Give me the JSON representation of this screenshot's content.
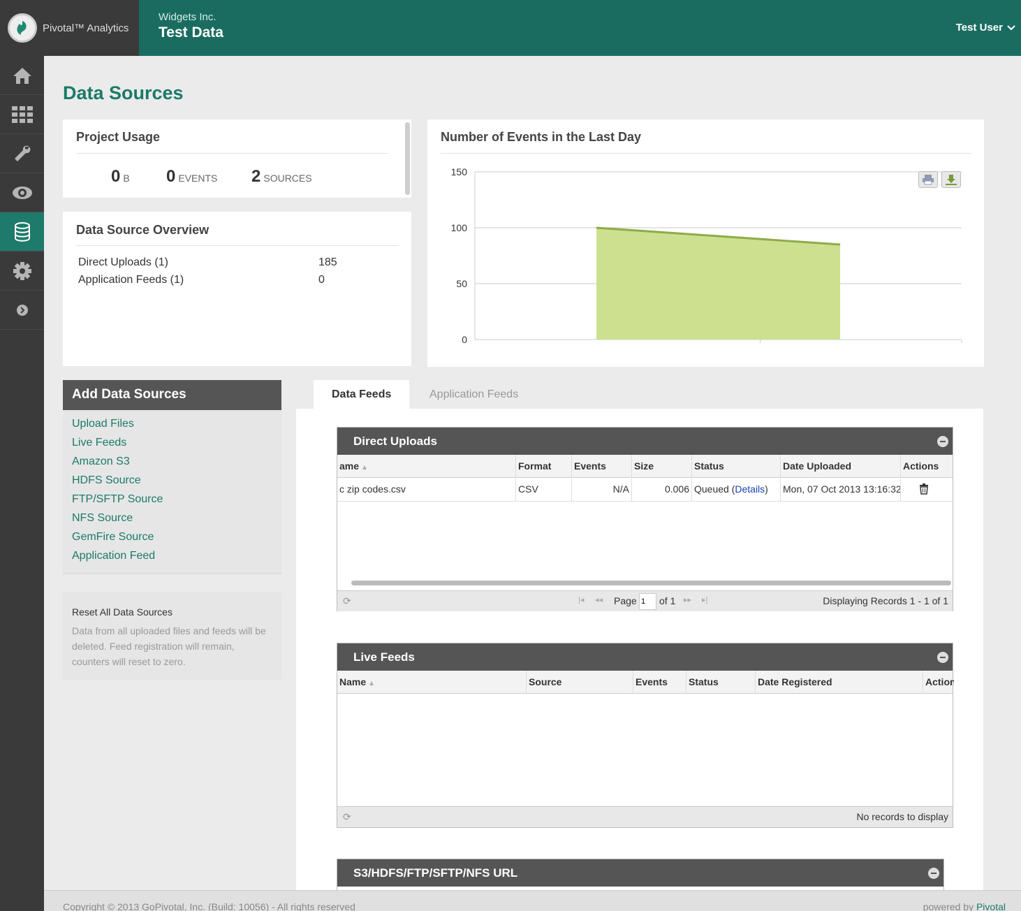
{
  "app": {
    "name": "Pivotal™ Analytics",
    "org": "Widgets Inc.",
    "project": "Test Data",
    "user": "Test User"
  },
  "sidebar": {
    "items": [
      {
        "icon": "home-icon"
      },
      {
        "icon": "grid-icon"
      },
      {
        "icon": "wrench-icon"
      },
      {
        "icon": "eye-icon"
      },
      {
        "icon": "database-icon",
        "active": true
      },
      {
        "icon": "gear-icon"
      },
      {
        "icon": "expand-arrow-icon"
      }
    ]
  },
  "page": {
    "title": "Data Sources"
  },
  "usage": {
    "title": "Project Usage",
    "bytes": {
      "value": "0",
      "unit": "B"
    },
    "events": {
      "value": "0",
      "unit": "EVENTS"
    },
    "sources": {
      "value": "2",
      "unit": "SOURCES"
    }
  },
  "overview": {
    "title": "Data Source Overview",
    "rows": [
      {
        "label": "Direct Uploads (1)",
        "value": "185"
      },
      {
        "label": "Application Feeds (1)",
        "value": "0"
      }
    ]
  },
  "chart_data": {
    "type": "area",
    "title": "Number of Events in the Last Day",
    "x": [
      0,
      1
    ],
    "values": [
      100,
      85
    ],
    "ylim": [
      0,
      150
    ],
    "yticks": [
      "0",
      "50",
      "100",
      "150"
    ],
    "grid": true,
    "color": "#cce08f",
    "line_color": "#8eab4a"
  },
  "add_sources": {
    "title": "Add Data Sources",
    "links": [
      "Upload Files",
      "Live Feeds",
      "Amazon S3",
      "HDFS Source",
      "FTP/SFTP Source",
      "NFS Source",
      "GemFire Source",
      "Application Feed"
    ]
  },
  "reset": {
    "title": "Reset All Data Sources",
    "description": "Data from all uploaded files and feeds will be deleted. Feed registration will remain, counters will reset to zero."
  },
  "tabs": {
    "data_feeds": "Data Feeds",
    "application_feeds": "Application Feeds"
  },
  "direct_uploads": {
    "title": "Direct Uploads",
    "columns": [
      "ame",
      "Format",
      "Events",
      "Size",
      "Status",
      "Date Uploaded",
      "Actions"
    ],
    "row": {
      "name": "c zip codes.csv",
      "format": "CSV",
      "events": "N/A",
      "size": "0.006",
      "status": "Queued (",
      "details": "Details",
      "status_end": ")",
      "date": "Mon, 07 Oct 2013 13:16:32"
    },
    "pager": {
      "page_label": "Page",
      "page_value": "1",
      "of": "of 1",
      "display": "Displaying Records 1 - 1 of 1"
    }
  },
  "live_feeds": {
    "title": "Live Feeds",
    "columns": [
      "Name",
      "Source",
      "Events",
      "Status",
      "Date Registered",
      "Action"
    ],
    "empty": "No records to display"
  },
  "url_section": {
    "title": "S3/HDFS/FTP/SFTP/NFS URL"
  },
  "footer": {
    "copyright": "Copyright © 2013 GoPivotal, Inc. (Build: 10056) - All rights reserved",
    "powered_prefix": "powered by ",
    "powered_brand": "Pivotal"
  }
}
